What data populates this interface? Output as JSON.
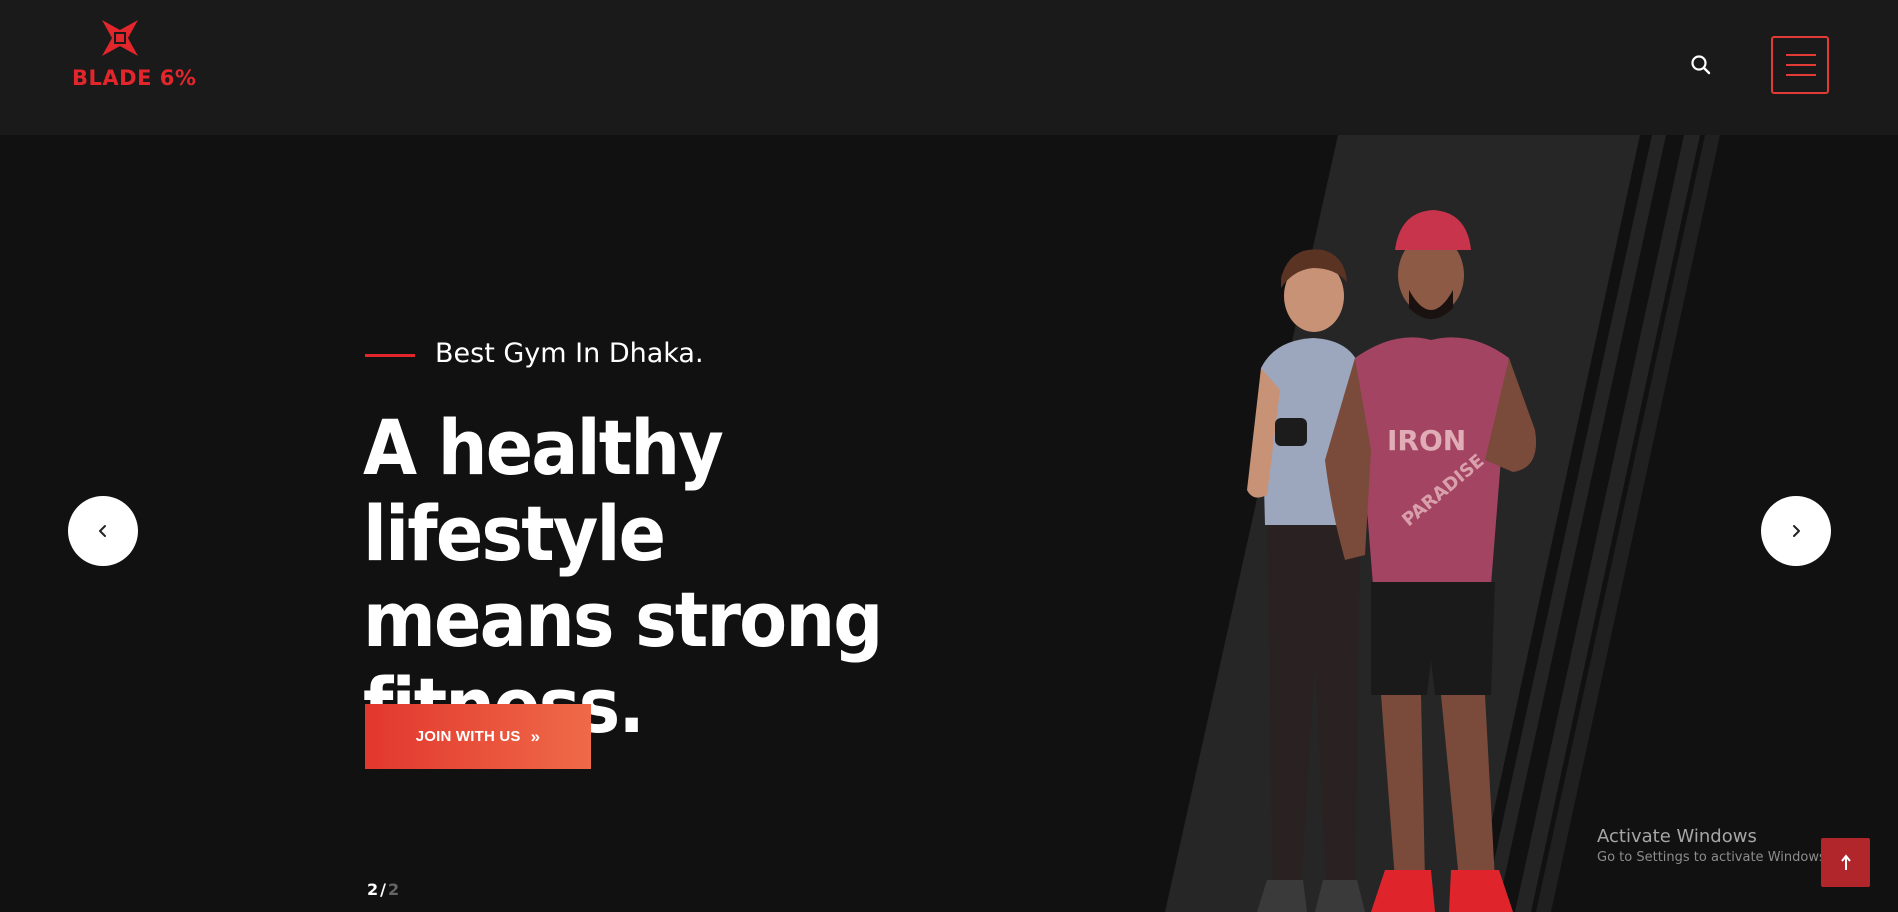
{
  "header": {
    "logo_text": "BLADE 6%",
    "search_icon": "search-icon",
    "menu_icon": "hamburger-menu-icon"
  },
  "hero": {
    "subtitle": "Best Gym In Dhaka.",
    "headline_lines": [
      "A healthy lifestyle",
      "means strong",
      "fitness."
    ],
    "cta_label": "JOIN WITH US",
    "cta_icon": "double-chevron-right-icon",
    "prev_icon": "chevron-left-icon",
    "next_icon": "chevron-right-icon",
    "slide_current": "2",
    "slide_separator": "/",
    "slide_total": "2"
  },
  "overlay": {
    "windows_title": "Activate Windows",
    "windows_subtitle": "Go to Settings to activate Windows."
  },
  "colors": {
    "accent": "#e3262c",
    "cta_start": "#e2372e",
    "cta_end": "#ef6a48",
    "header_bg": "#1a1a1a",
    "hero_bg": "#111111"
  }
}
